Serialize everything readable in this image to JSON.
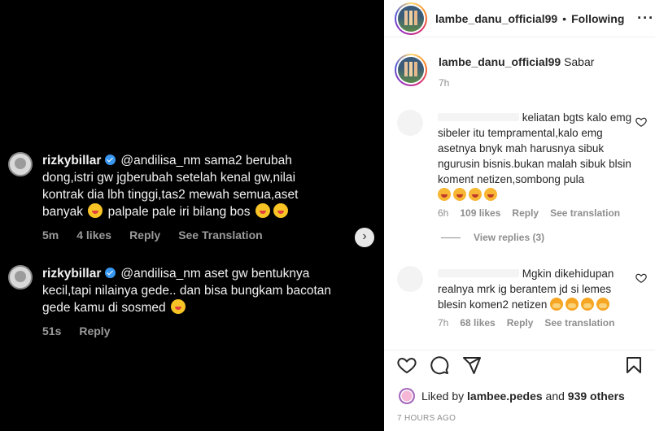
{
  "media": {
    "comments": [
      {
        "user": "rizkybillar",
        "text": "@andilisa_nm sama2 berubah dong,istri gw jgberubah setelah kenal gw,nilai kontrak dia lbh tinggi,tas2 mewah semua,aset banyak",
        "text_tail": "palpale pale iri bilang bos",
        "time": "5m",
        "likes": "4 likes",
        "reply": "Reply",
        "translate": "See Translation"
      },
      {
        "user": "rizkybillar",
        "text": "@andilisa_nm aset gw bentuknya kecil,tapi nilainya gede.. dan bisa bungkam bacotan gede kamu di sosmed",
        "time": "51s",
        "reply": "Reply"
      }
    ]
  },
  "header": {
    "username": "lambe_danu_official99",
    "dot": "•",
    "follow_label": "Following",
    "more": "···"
  },
  "caption": {
    "username": "lambe_danu_official99",
    "text": "Sabar",
    "time": "7h"
  },
  "comments": [
    {
      "text": "keliatan bgts kalo emg sibeler itu tempramental,kalo emg asetnya bnyk mah harusnya sibuk ngurusin bisnis.bukan malah sibuk blsin koment netizen,sombong pula",
      "time": "6h",
      "likes": "109 likes",
      "reply": "Reply",
      "translate": "See translation",
      "view_replies": "View replies (3)"
    },
    {
      "text": "Mgkin dikehidupan realnya mrk ig berantem jd si lemes blesin komen2 netizen",
      "time": "7h",
      "likes": "68 likes",
      "reply": "Reply",
      "translate": "See translation"
    }
  ],
  "likes_line": {
    "prefix": "Liked by",
    "user": "lambee.pedes",
    "and": "and",
    "others": "939 others"
  },
  "posted": "7 HOURS AGO",
  "icons": [
    "like-heart-icon",
    "comment-icon",
    "share-icon",
    "save-icon",
    "more-icon",
    "verified-icon",
    "chevron-right-icon"
  ],
  "colors": {
    "verified": "#3897f0",
    "muted": "#8e8e8e",
    "text": "#262626"
  }
}
